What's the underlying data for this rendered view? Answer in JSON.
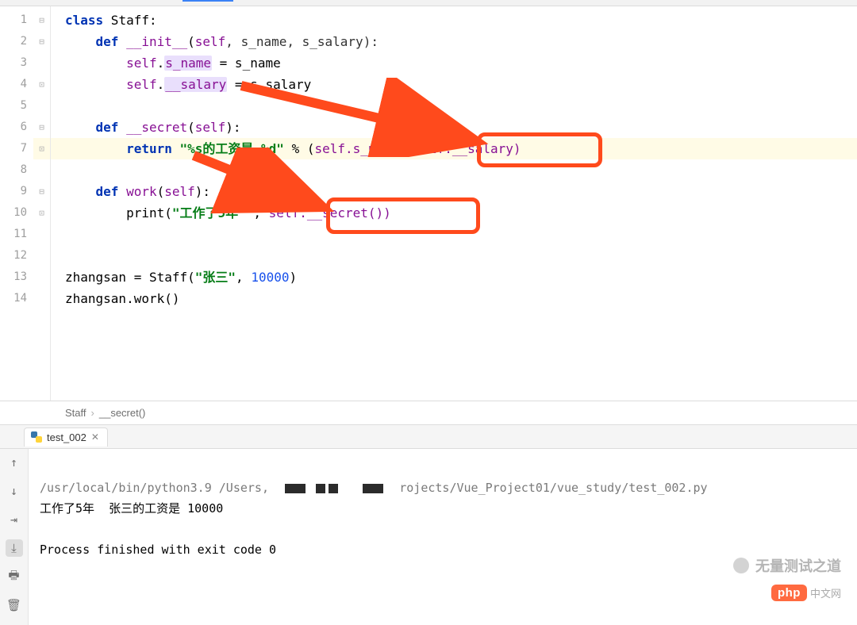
{
  "editor": {
    "line_numbers": [
      "1",
      "2",
      "3",
      "4",
      "5",
      "6",
      "7",
      "8",
      "9",
      "10",
      "11",
      "12",
      "13",
      "14"
    ],
    "fold_markers": [
      "open",
      "open",
      "",
      "end",
      "",
      "open",
      "hl-end",
      "",
      "open",
      "end",
      "",
      "",
      "",
      ""
    ],
    "code": {
      "l1_kw_class": "class",
      "l1_name": " Staff:",
      "l2_kw_def": "def ",
      "l2_dunder": "__init__",
      "l2_sig": "(",
      "l2_self": "self",
      "l2_params": ", s_name, s_salary):",
      "l3_self": "self",
      "l3_dot_field": ".",
      "l3_field_hl": "s_name",
      "l3_rest": " = s_name",
      "l4_self": "self",
      "l4_dot": ".",
      "l4_field_hl": "__salary",
      "l4_rest": " = s_salary",
      "l6_kw_def": "def ",
      "l6_name": "__secret",
      "l6_sig_open": "(",
      "l6_self": "self",
      "l6_sig_close": "):",
      "l7_kw_return": "return ",
      "l7_str": "\"%s的工资是 %d\"",
      "l7_op": " % (",
      "l7_self1": "self",
      "l7_field1": ".s_name, ",
      "l7_self2": "self",
      "l7_field2": ".__salary)",
      "l9_kw_def": "def ",
      "l9_name": "work",
      "l9_sig_open": "(",
      "l9_self": "self",
      "l9_sig_close": "):",
      "l10_print": "print(",
      "l10_str": "\"工作了5年 \"",
      "l10_comma": ", ",
      "l10_self": "self",
      "l10_call": ".__secret())",
      "l13_lhs": "zhangsan = Staff(",
      "l13_str": "\"张三\"",
      "l13_comma": ", ",
      "l13_num": "10000",
      "l13_close": ")",
      "l14": "zhangsan.work()"
    }
  },
  "breadcrumb": {
    "class": "Staff",
    "method": "__secret()"
  },
  "run_tab": {
    "label": "test_002"
  },
  "console": {
    "path_left": "/usr/local/bin/python3.9 /Users,",
    "path_right": "rojects/Vue_Project01/vue_study/test_002.py",
    "output_line": "工作了5年  张三的工资是 10000",
    "blank": "",
    "exit": "Process finished with exit code 0"
  },
  "watermarks": {
    "top": "无量测试之道",
    "php": "php",
    "cn": "中文网"
  },
  "colors": {
    "highlight_box": "#ff4a1c",
    "line_highlight": "#fffbe6"
  }
}
